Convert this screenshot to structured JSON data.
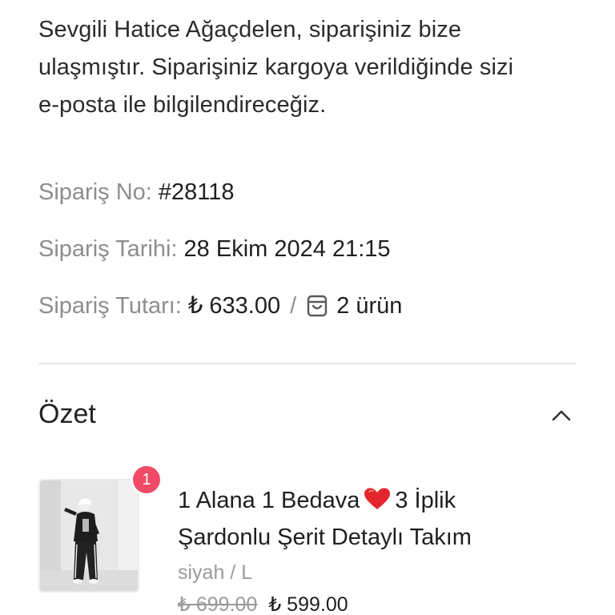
{
  "message": {
    "line1": "Sevgili Hatice Ağaçdelen, siparişiniz bize",
    "line2": "ulaşmıştır. Siparişiniz kargoya verildiğinde sizi",
    "line3": "e-posta ile bilgilendireceğiz."
  },
  "order": {
    "number_label": "Sipariş No:",
    "number_value": "#28118",
    "date_label": "Sipariş Tarihi:",
    "date_value": "28 Ekim 2024 21:15",
    "total_label": "Sipariş Tutarı:",
    "total_value": "₺ 633.00",
    "separator": "/",
    "items_count": "2 ürün",
    "items_icon": "shopping-bag-icon"
  },
  "summary": {
    "title": "Özet",
    "toggle_icon": "chevron-up-icon",
    "items": [
      {
        "quantity_badge": "1",
        "title_part1": "1 Alana 1 Bedava",
        "title_emoji": "red-heart-icon",
        "title_part2": "3 İplik",
        "title_line2": "Şardonlu Şerit Detaylı Takım",
        "variant": "siyah / L",
        "old_price": "₺ 699.00",
        "new_price": "₺ 599.00"
      }
    ]
  },
  "colors": {
    "badge": "#ef4a66",
    "label_gray": "#8e8e8e",
    "text_dark": "#1f1f1f",
    "divider": "#e6e6e6"
  }
}
